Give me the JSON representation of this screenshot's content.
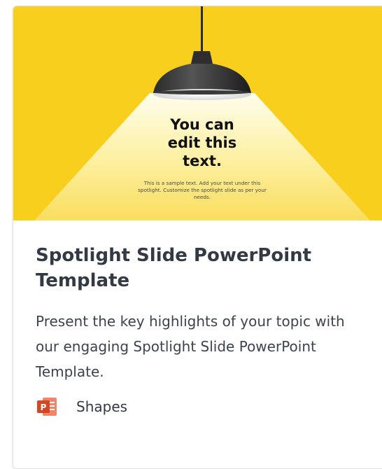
{
  "card": {
    "thumbnail": {
      "heading": "You can\nedit this\ntext.",
      "subtext": "This is a sample text. Add your text under this spotlight. Customize the spotlight slide as per your needs.",
      "background_color": "#f8cf1c",
      "lamp_icon": "ceiling-lamp"
    },
    "title": "Spotlight Slide PowerPoint Template",
    "description": "Present the key highlights of your topic with our engaging Spotlight Slide PowerPoint Template.",
    "meta": {
      "app_icon": "powerpoint-icon",
      "app_icon_color": "#d24726",
      "label": "Shapes"
    }
  }
}
